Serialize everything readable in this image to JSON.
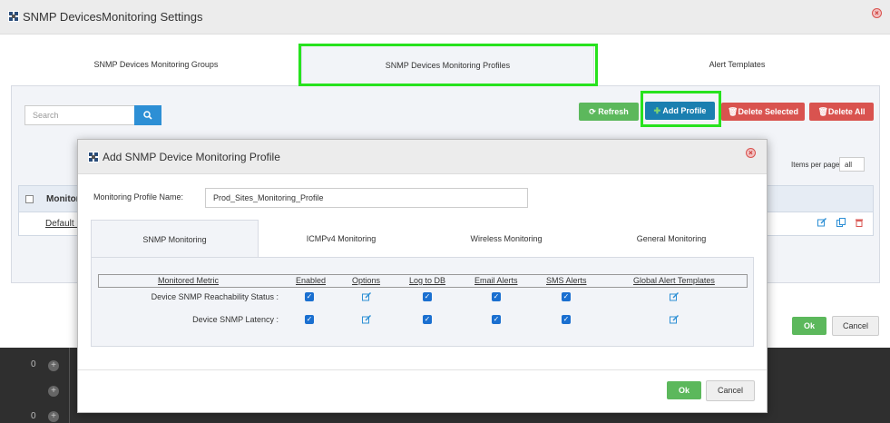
{
  "window": {
    "title": "SNMP DevicesMonitoring Settings"
  },
  "tabs": [
    {
      "label": "SNMP Devices Monitoring Groups"
    },
    {
      "label": "SNMP Devices Monitoring Profiles"
    },
    {
      "label": "Alert Templates"
    }
  ],
  "toolbar": {
    "search_placeholder": "Search",
    "refresh_label": "Refresh",
    "add_profile_label": "Add Profile",
    "delete_selected_label": "Delete Selected",
    "delete_all_label": "Delete All"
  },
  "pagination": {
    "items_per_page_label": "Items per page",
    "items_per_page_value": "all"
  },
  "table": {
    "header_label": "Monitoring Profile Name",
    "rows": [
      {
        "name": "Default Devices Monitoring Profile"
      }
    ]
  },
  "outer_footer": {
    "ok_label": "Ok",
    "cancel_label": "Cancel"
  },
  "background_list": {
    "counts": [
      "0",
      "0"
    ]
  },
  "modal": {
    "title": "Add SNMP Device Monitoring Profile",
    "profile_name_label": "Monitoring Profile Name:",
    "profile_name_value": "Prod_Sites_Monitoring_Profile",
    "tabs": [
      {
        "label": "SNMP Monitoring"
      },
      {
        "label": "ICMPv4 Monitoring"
      },
      {
        "label": "Wireless Monitoring"
      },
      {
        "label": "General Monitoring"
      }
    ],
    "grid": {
      "headers": [
        "Monitored Metric",
        "Enabled",
        "Options",
        "Log to DB",
        "Email Alerts",
        "SMS Alerts",
        "Global Alert Templates"
      ],
      "rows": [
        {
          "metric": "Device SNMP Reachability Status :",
          "enabled": true,
          "log_to_db": true,
          "email_alerts": true,
          "sms_alerts": true
        },
        {
          "metric": "Device SNMP Latency :",
          "enabled": true,
          "log_to_db": true,
          "email_alerts": true,
          "sms_alerts": true
        }
      ]
    },
    "ok_label": "Ok",
    "cancel_label": "Cancel"
  },
  "colors": {
    "highlight": "#27e21e",
    "primary": "#1a7fb0",
    "success": "#5cb85c",
    "danger": "#d9534f",
    "checkbox": "#1a6fd0"
  }
}
